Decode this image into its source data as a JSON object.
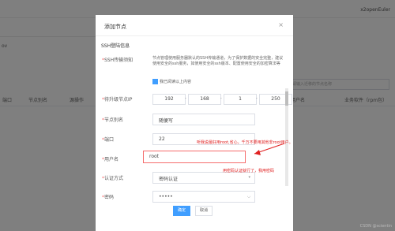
{
  "background": {
    "user_text": "x2openEuler",
    "left_text": "ov",
    "search_placeholder": "请输入迁移的节点名称",
    "table_headers": [
      "端口",
      "节点别名",
      "源操作",
      "用户名",
      "业务软件（rpm包）"
    ]
  },
  "dialog": {
    "title": "添加节点",
    "close": "×",
    "section_title": "SSH登陆信息",
    "notice_label": "SSH传输须知",
    "notice_text": "节点管理使用服务器默认的SSH传输通道，为了保护数据的安全完整，建议使用安全的ssh服务，如使用安全的ssh版本、配置使用安全的加密算法等",
    "checkbox_label": "我已阅读以上内容",
    "ip_label": "待升级节点IP",
    "ip": [
      "192",
      "168",
      "1",
      "250"
    ],
    "alias_label": "节点别名",
    "alias_value": "随便写",
    "port_label": "端口",
    "port_value": "22",
    "username_label": "用户名",
    "username_value": "root",
    "auth_label": "认证方式",
    "auth_value": "密码认证",
    "password_label": "密码",
    "password_value": "•••••",
    "ok_label": "确定",
    "cancel_label": "取消"
  },
  "annotations": {
    "root_note": "听我说最好用root,省心，千万不要用其他非root用户。",
    "auth_note": "用密码认证就行了，我用密码"
  },
  "watermark": "CSDN @scientin"
}
